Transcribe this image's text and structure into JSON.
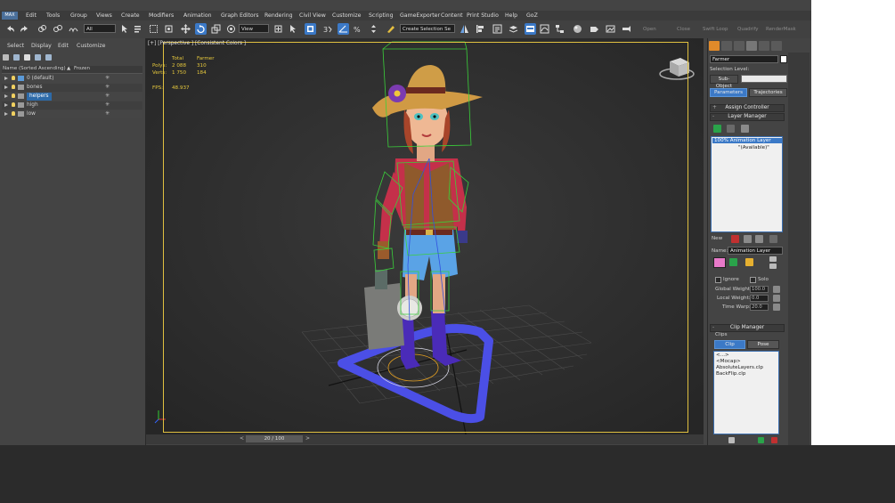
{
  "app": {
    "logo": "MAX"
  },
  "menu": [
    "Edit",
    "Tools",
    "Group",
    "Views",
    "Create",
    "Modifiers",
    "Animation",
    "Graph Editors",
    "Rendering",
    "Civil View",
    "Customize",
    "Scripting",
    "GameExporter",
    "Content",
    "Print Studio",
    "Help",
    "GoZ"
  ],
  "toolbar": {
    "filter_value": "All",
    "refcoord_value": "View",
    "selection_set": "Create Selection Se",
    "right_labels": [
      "Open",
      "Close",
      "Swift Loop",
      "Quadrify",
      "RenderMask"
    ]
  },
  "scene_explorer": {
    "menu": [
      "Select",
      "Display",
      "Edit",
      "Customize"
    ],
    "col_name": "Name (Sorted Ascending)",
    "col_sort": "▲",
    "col_frozen": "Frozen",
    "layers": [
      {
        "name": "0 (default)",
        "selected": false
      },
      {
        "name": "bones",
        "selected": false
      },
      {
        "name": "helpers",
        "selected": true
      },
      {
        "name": "high",
        "selected": false
      },
      {
        "name": "low",
        "selected": false
      }
    ]
  },
  "viewport": {
    "label": "[+] [Perspective ] [Consistent Colors ]",
    "stats": {
      "hdr_total": "Total",
      "hdr_obj": "Farmer",
      "polys_label": "Polys:",
      "polys_total": "2 088",
      "polys_obj": "310",
      "verts_label": "Verts:",
      "verts_total": "1 750",
      "verts_obj": "184",
      "fps_label": "FPS:",
      "fps_value": "48.937"
    }
  },
  "timeline": {
    "frame": "20 / 100",
    "prev": "<",
    "next": ">"
  },
  "command_panel": {
    "object_name": "Farmer",
    "selection_level": "Selection Level:",
    "sub_object": "Sub-Object",
    "tabs": [
      "Parameters",
      "Trajectories"
    ],
    "assign_controller": "Assign Controller",
    "layer_manager": {
      "title": "Layer Manager",
      "layers": [
        "100% Animation Layer",
        "\"(Available)\""
      ],
      "name_label": "Name:",
      "name_value": "Animation Layer",
      "ignore": "Ignore",
      "solo": "Solo",
      "global_weight_label": "Global Weight:",
      "global_weight": "100.0",
      "local_weight_label": "Local Weight:",
      "local_weight": "0.0",
      "time_warp_label": "Time Warp:",
      "time_warp": "20.0",
      "new_label": "New"
    },
    "clip_manager": {
      "title": "Clip Manager",
      "group": "Clips",
      "tabs": [
        "Clip",
        "Pose"
      ],
      "clips": [
        "<...>",
        "<Mocap>",
        "AbsoluteLayers.clp",
        "BackFlip.clp"
      ]
    }
  }
}
